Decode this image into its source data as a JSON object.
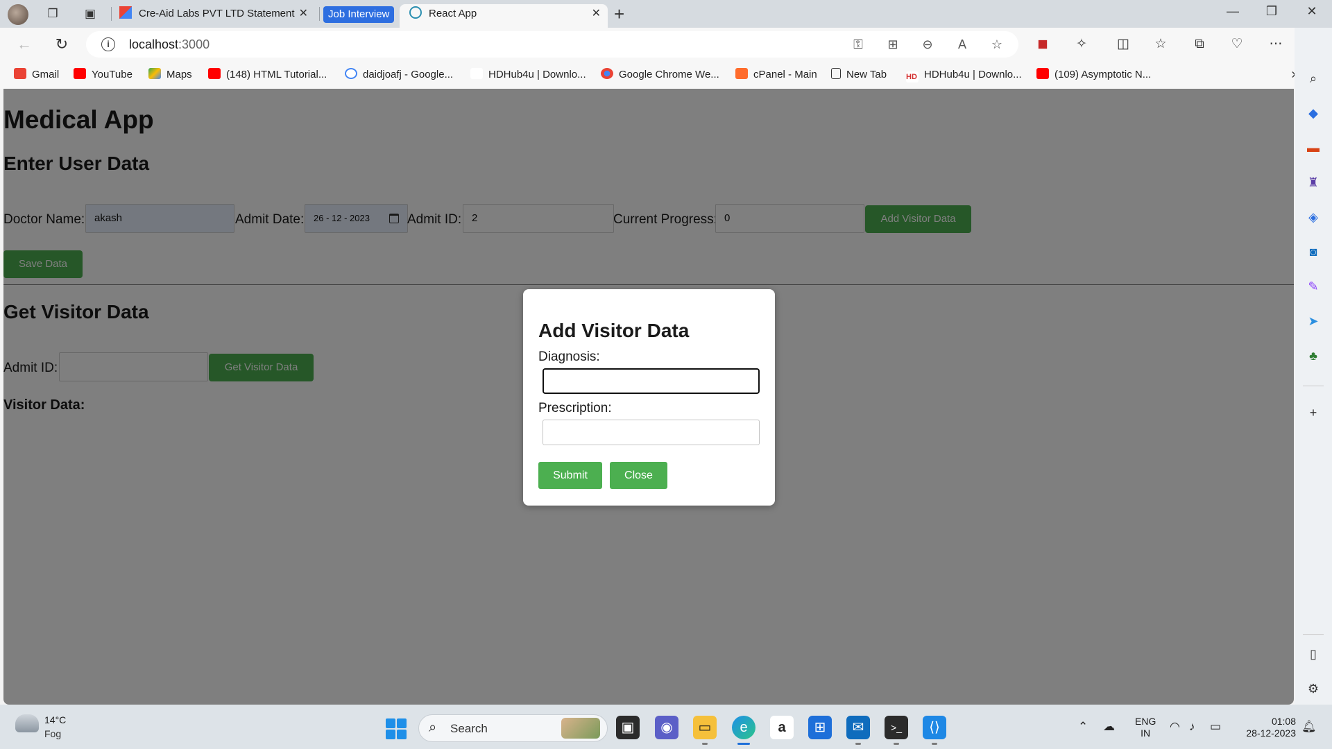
{
  "browser": {
    "tabs": [
      {
        "label": "Cre-Aid Labs PVT LTD Statement"
      },
      {
        "label": "React App"
      }
    ],
    "tab_group_label": "Job Interview",
    "url_host": "localhost",
    "url_port": ":3000",
    "bookmarks": [
      {
        "label": "Gmail"
      },
      {
        "label": "YouTube"
      },
      {
        "label": "Maps"
      },
      {
        "label": "(148) HTML Tutorial..."
      },
      {
        "label": "daidjoafj - Google..."
      },
      {
        "label": "HDHub4u | Downlo..."
      },
      {
        "label": "Google Chrome We..."
      },
      {
        "label": "cPanel - Main"
      },
      {
        "label": "New Tab"
      },
      {
        "label": "HDHub4u | Downlo..."
      },
      {
        "label": "(109) Asymptotic N..."
      }
    ]
  },
  "app": {
    "title": "Medical App",
    "enter_section": {
      "heading": "Enter User Data",
      "doctor_label": "Doctor Name:",
      "doctor_value": "akash",
      "date_label": "Admit Date:",
      "date_value": "26 - 12 - 2023",
      "admit_id_label": "Admit ID:",
      "admit_id_value": "2",
      "progress_label": "Current Progress:",
      "progress_value": "0",
      "add_visitor_button": "Add Visitor Data",
      "save_button": "Save Data"
    },
    "get_section": {
      "heading": "Get Visitor Data",
      "admit_id_label": "Admit ID:",
      "admit_id_value": "",
      "get_button": "Get Visitor Data",
      "visitor_data_label": "Visitor Data:"
    },
    "modal": {
      "title": "Add Visitor Data",
      "diagnosis_label": "Diagnosis:",
      "diagnosis_value": "",
      "prescription_label": "Prescription:",
      "prescription_value": "",
      "submit_button": "Submit",
      "close_button": "Close"
    }
  },
  "taskbar": {
    "weather_temp": "14°C",
    "weather_desc": "Fog",
    "search_label": "Search",
    "lang_line1": "ENG",
    "lang_line2": "IN",
    "time": "01:08",
    "date": "28-12-2023"
  },
  "colors": {
    "accent_green": "#4caf50",
    "overlay": "rgba(0,0,0,0.5)",
    "tab_group": "#2d6ee0"
  }
}
